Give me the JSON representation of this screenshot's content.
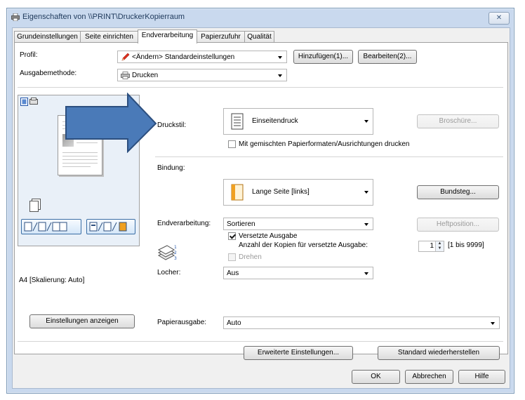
{
  "window": {
    "title": "Eigenschaften von \\\\PRINT\\DruckerKopierraum",
    "close_label": "✕"
  },
  "tabs": [
    {
      "label": "Grundeinstellungen"
    },
    {
      "label": "Seite einrichten"
    },
    {
      "label": "Endverarbeitung"
    },
    {
      "label": "Papierzufuhr"
    },
    {
      "label": "Qualität"
    }
  ],
  "profile": {
    "label": "Profil:",
    "value": "<Ändern> Standardeinstellungen",
    "add_button": "Hinzufügen(1)...",
    "edit_button": "Bearbeiten(2)..."
  },
  "output": {
    "label": "Ausgabemethode:",
    "value": "Drucken"
  },
  "style": {
    "label": "Druckstil:",
    "value": "Einseitendruck",
    "brochure_button": "Broschüre...",
    "mixed_checkbox": "Mit gemischten Papierformaten/Ausrichtungen drucken",
    "mixed_checked": false
  },
  "binding": {
    "label": "Bindung:",
    "value": "Lange Seite [links]",
    "gutter_button": "Bundsteg..."
  },
  "finishing": {
    "label": "Endverarbeitung:",
    "value": "Sortieren",
    "staple_button": "Heftposition...",
    "offset_checkbox": "Versetzte Ausgabe",
    "offset_checked": true,
    "copies_label": "Anzahl der Kopien für versetzte Ausgabe:",
    "copies_value": "1",
    "copies_range": "[1 bis 9999]",
    "rotate_checkbox": "Drehen",
    "rotate_checked": false
  },
  "punch": {
    "label": "Locher:",
    "value": "Aus"
  },
  "paper_output": {
    "label": "Papierausgabe:",
    "value": "Auto"
  },
  "preview": {
    "caption": "A4 [Skalierung: Auto]",
    "show_settings_button": "Einstellungen anzeigen"
  },
  "footer": {
    "advanced_button": "Erweiterte Einstellungen...",
    "restore_button": "Standard wiederherstellen",
    "ok_button": "OK",
    "cancel_button": "Abbrechen",
    "help_button": "Hilfe"
  },
  "colors": {
    "arrow_fill": "#4a7ab8",
    "arrow_stroke": "#2c4f7f",
    "pencil": "#e03020",
    "book_orange": "#f0a020"
  }
}
